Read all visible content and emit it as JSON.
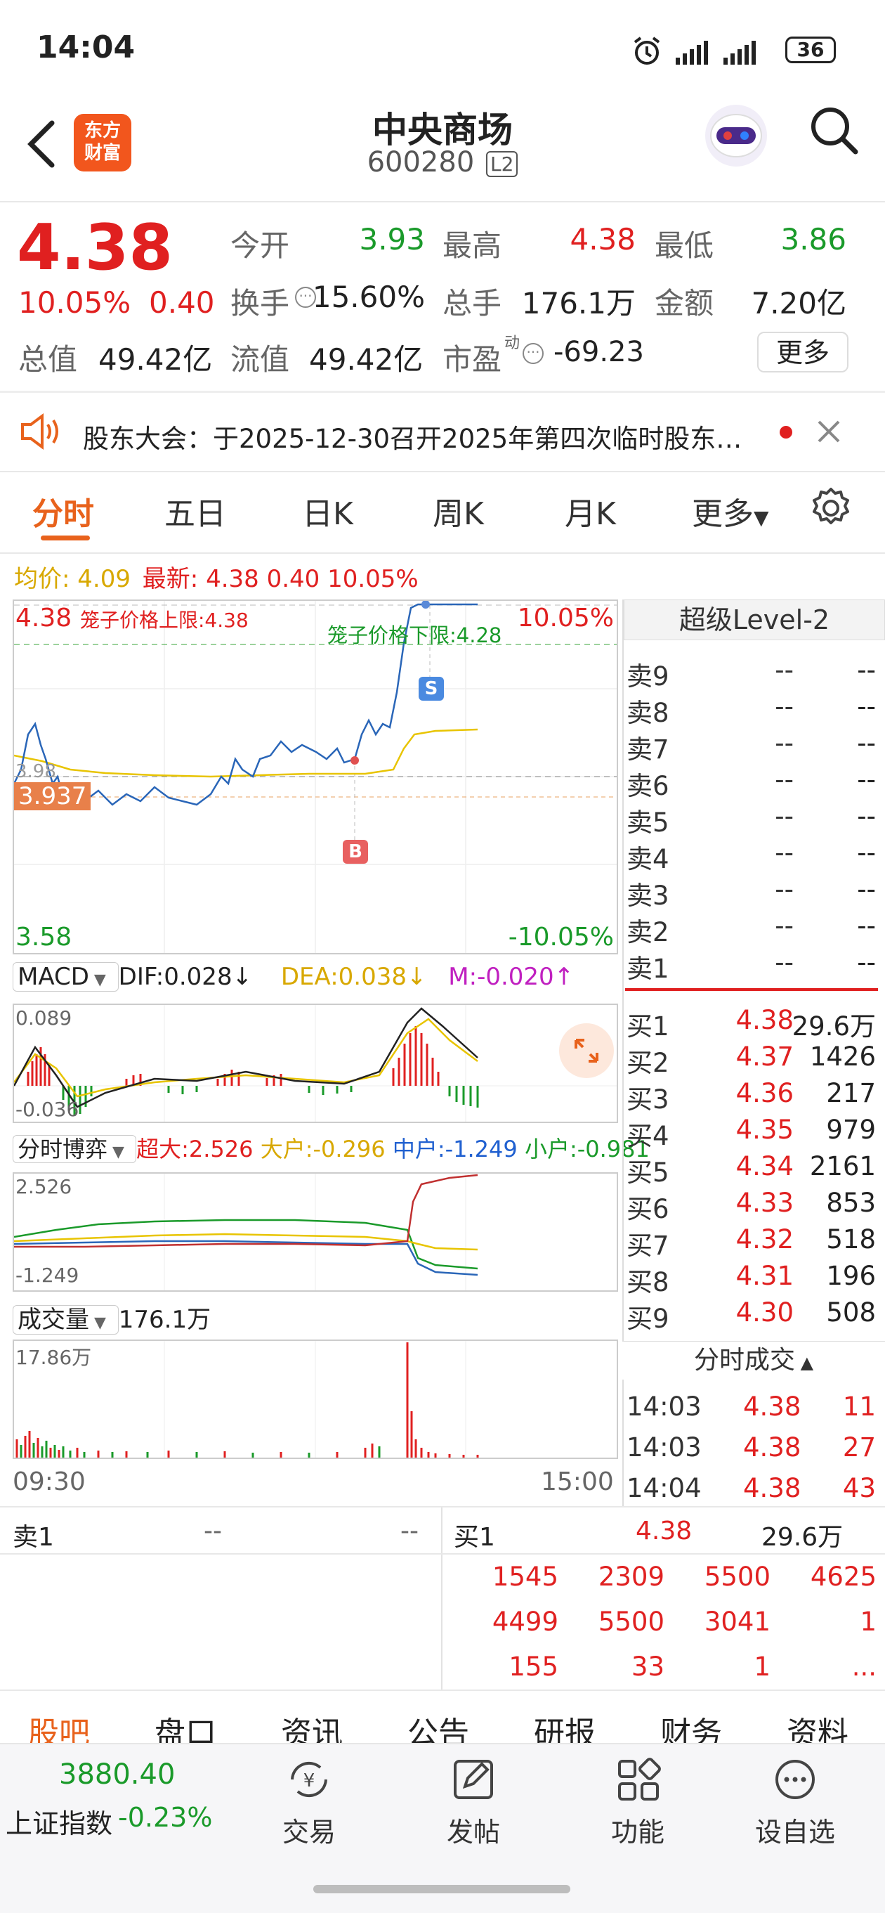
{
  "status_bar": {
    "time": "14:04",
    "battery": "36"
  },
  "header": {
    "title": "中央商场",
    "code": "600280",
    "badge": "L2",
    "brand_line1": "东方",
    "brand_line2": "财富"
  },
  "quote": {
    "price": "4.38",
    "change_pct": "10.05%",
    "change": "0.40",
    "open_label": "今开",
    "open": "3.93",
    "high_label": "最高",
    "high": "4.38",
    "low_label": "最低",
    "low": "3.86",
    "turnover_label": "换手",
    "turnover": "15.60%",
    "volume_label": "总手",
    "volume": "176.1万",
    "amount_label": "金额",
    "amount": "7.20亿",
    "mktcap_label": "总值",
    "mktcap": "49.42亿",
    "float_label": "流值",
    "float": "49.42亿",
    "pe_label": "市盈",
    "pe_sup": "动",
    "pe": "-69.23",
    "more_button": "更多"
  },
  "notice": {
    "text": "股东大会：于2025-12-30召开2025年第四次临时股东…"
  },
  "tabs": [
    "分时",
    "五日",
    "日K",
    "周K",
    "月K",
    "更多"
  ],
  "chart_legend": {
    "avg_label": "均价:",
    "avg": "4.09",
    "latest_label": "最新:",
    "latest": "4.38 0.40 10.05%"
  },
  "intraday": {
    "top_price": "4.38",
    "top_pct": "10.05%",
    "bottom_price": "3.58",
    "bottom_pct": "-10.05%",
    "upper_limit_label": "笼子价格上限:4.38",
    "lower_limit_label": "笼子价格下限:4.28",
    "mid_price_label": "3.98",
    "cursor_price": "3.937",
    "buy_marker": "B",
    "sell_marker": "S",
    "time_start": "09:30",
    "time_end": "15:00"
  },
  "macd": {
    "label": "MACD",
    "dif": "DIF:0.028↓",
    "dea": "DEA:0.038↓",
    "m": "M:-0.020↑",
    "max": "0.089",
    "min": "-0.036"
  },
  "game": {
    "label": "分时博弈",
    "super": "超大:2.526",
    "large": "大户:-0.296",
    "mid": "中户:-1.249",
    "small": "小户:-0.981",
    "max": "2.526",
    "min": "-1.249"
  },
  "vol": {
    "label": "成交量",
    "total": "176.1万",
    "max": "17.86万"
  },
  "level2": {
    "title": "超级Level-2",
    "asks": [
      {
        "label": "卖9",
        "price": "--",
        "vol": "--"
      },
      {
        "label": "卖8",
        "price": "--",
        "vol": "--"
      },
      {
        "label": "卖7",
        "price": "--",
        "vol": "--"
      },
      {
        "label": "卖6",
        "price": "--",
        "vol": "--"
      },
      {
        "label": "卖5",
        "price": "--",
        "vol": "--"
      },
      {
        "label": "卖4",
        "price": "--",
        "vol": "--"
      },
      {
        "label": "卖3",
        "price": "--",
        "vol": "--"
      },
      {
        "label": "卖2",
        "price": "--",
        "vol": "--"
      },
      {
        "label": "卖1",
        "price": "--",
        "vol": "--"
      }
    ],
    "bids": [
      {
        "label": "买1",
        "price": "4.38",
        "vol": "29.6万"
      },
      {
        "label": "买2",
        "price": "4.37",
        "vol": "1426"
      },
      {
        "label": "买3",
        "price": "4.36",
        "vol": "217"
      },
      {
        "label": "买4",
        "price": "4.35",
        "vol": "979"
      },
      {
        "label": "买5",
        "price": "4.34",
        "vol": "2161"
      },
      {
        "label": "买6",
        "price": "4.33",
        "vol": "853"
      },
      {
        "label": "买7",
        "price": "4.32",
        "vol": "518"
      },
      {
        "label": "买8",
        "price": "4.31",
        "vol": "196"
      },
      {
        "label": "买9",
        "price": "4.30",
        "vol": "508"
      }
    ],
    "ticks_title": "分时成交",
    "ticks": [
      {
        "time": "14:03",
        "price": "4.38",
        "vol": "11"
      },
      {
        "time": "14:03",
        "price": "4.38",
        "vol": "27"
      },
      {
        "time": "14:04",
        "price": "4.38",
        "vol": "43"
      }
    ]
  },
  "queue": {
    "sell_label": "卖1",
    "sell_price": "--",
    "sell_vol": "--",
    "buy_label": "买1",
    "buy_price": "4.38",
    "buy_vol": "29.6万",
    "rows": [
      [
        "1545",
        "2309",
        "5500",
        "4625"
      ],
      [
        "4499",
        "5500",
        "3041",
        "1"
      ],
      [
        "155",
        "33",
        "1",
        "..."
      ]
    ]
  },
  "bottom_tabs": [
    "股吧",
    "盘口",
    "资讯",
    "公告",
    "研报",
    "财务",
    "资料"
  ],
  "bottom_nav": {
    "index_value": "3880.40",
    "index_name": "上证指数",
    "index_change": "-0.23%",
    "items": [
      "交易",
      "发帖",
      "功能",
      "设自选"
    ]
  },
  "colors": {
    "up": "#e02020",
    "down": "#1a9a2a",
    "accent": "#e8621c",
    "price_line": "#2a66b8",
    "avg_line": "#e8c400"
  }
}
